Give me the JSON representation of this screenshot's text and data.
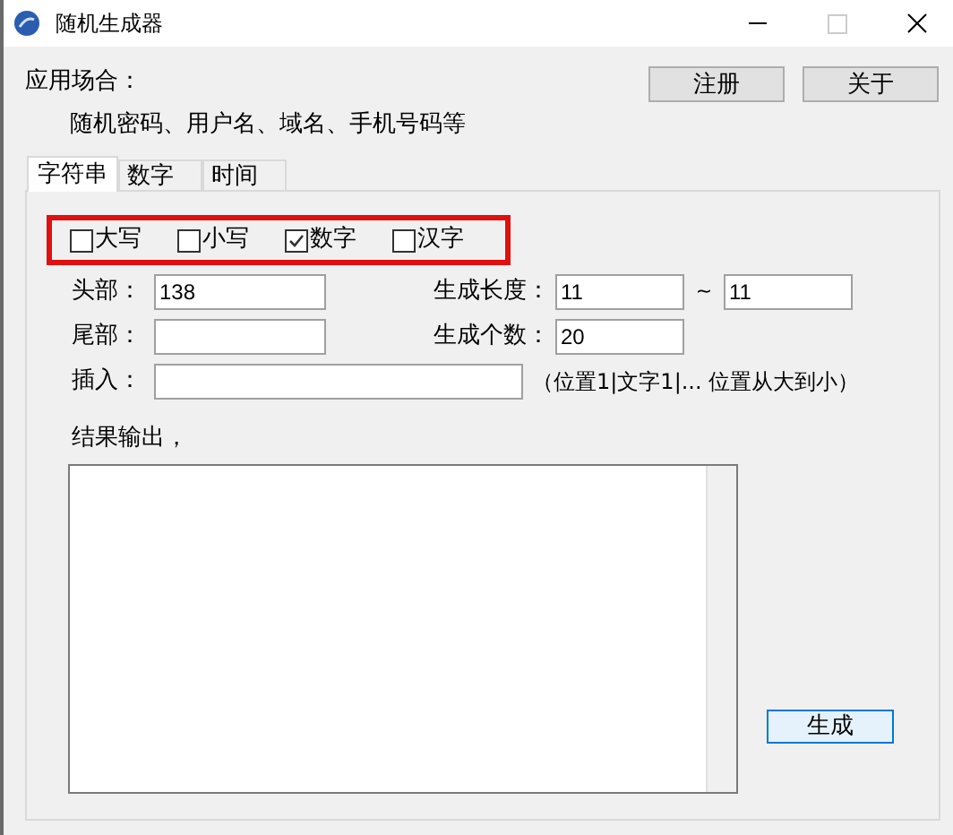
{
  "window": {
    "title": "随机生成器"
  },
  "usage": {
    "label": "应用场合：",
    "description": "随机密码、用户名、域名、手机号码等"
  },
  "buttons": [
    "注册",
    "关于"
  ],
  "tabs": [
    {
      "label": "字符串",
      "selected": true
    },
    {
      "label": "数字",
      "selected": false
    },
    {
      "label": "时间",
      "selected": false
    }
  ],
  "options": [
    {
      "label": "大写",
      "checked": false
    },
    {
      "label": "小写",
      "checked": false
    },
    {
      "label": "数字",
      "checked": true
    },
    {
      "label": "汉字",
      "checked": false
    }
  ],
  "head": {
    "label": "头部：",
    "value": "138"
  },
  "tail": {
    "label": "尾部："
  },
  "length": {
    "label": "生成长度：",
    "min": "11",
    "separator": "~",
    "max": "11"
  },
  "count": {
    "label": "生成个数：",
    "value": "20"
  },
  "insert": {
    "label": "插入：",
    "hint": "（位置1|文字1|... 位置从大到小）"
  },
  "output": {
    "label": "结果输出，"
  },
  "generate_button": "生成"
}
